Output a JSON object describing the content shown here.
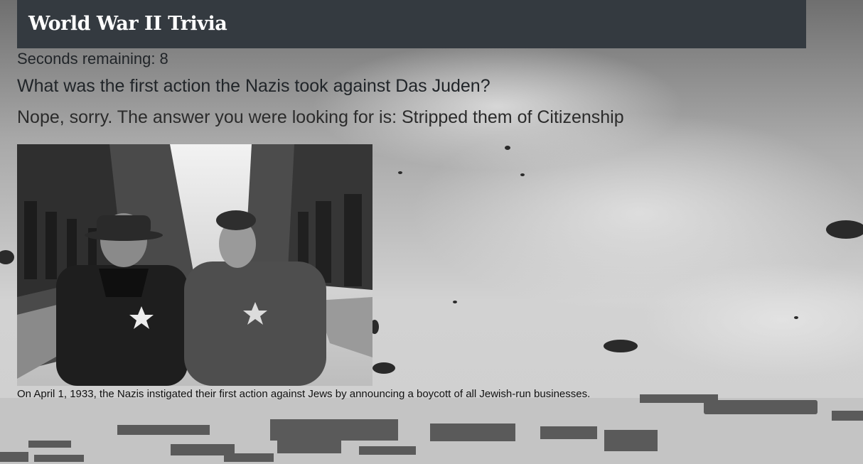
{
  "header": {
    "title": "World War II Trivia"
  },
  "quiz": {
    "timer_text": "Seconds remaining: 8",
    "question": "What was the first action the Nazis took against Das Juden?",
    "answer_feedback": "Nope, sorry. The answer you were looking for is: Stripped them of Citizenship",
    "caption": "On April 1, 1933, the Nazis instigated their first action against Jews by announcing a boycott of all Jewish-run businesses."
  },
  "colors": {
    "header_bg": "#343a40",
    "header_text": "#ffffff",
    "body_text": "#212529"
  },
  "images": {
    "background": "black-and-white-wartime-harbor-with-barrage-balloons",
    "answer_photo": "black-and-white-photo-of-couple-wearing-stars-on-street"
  }
}
